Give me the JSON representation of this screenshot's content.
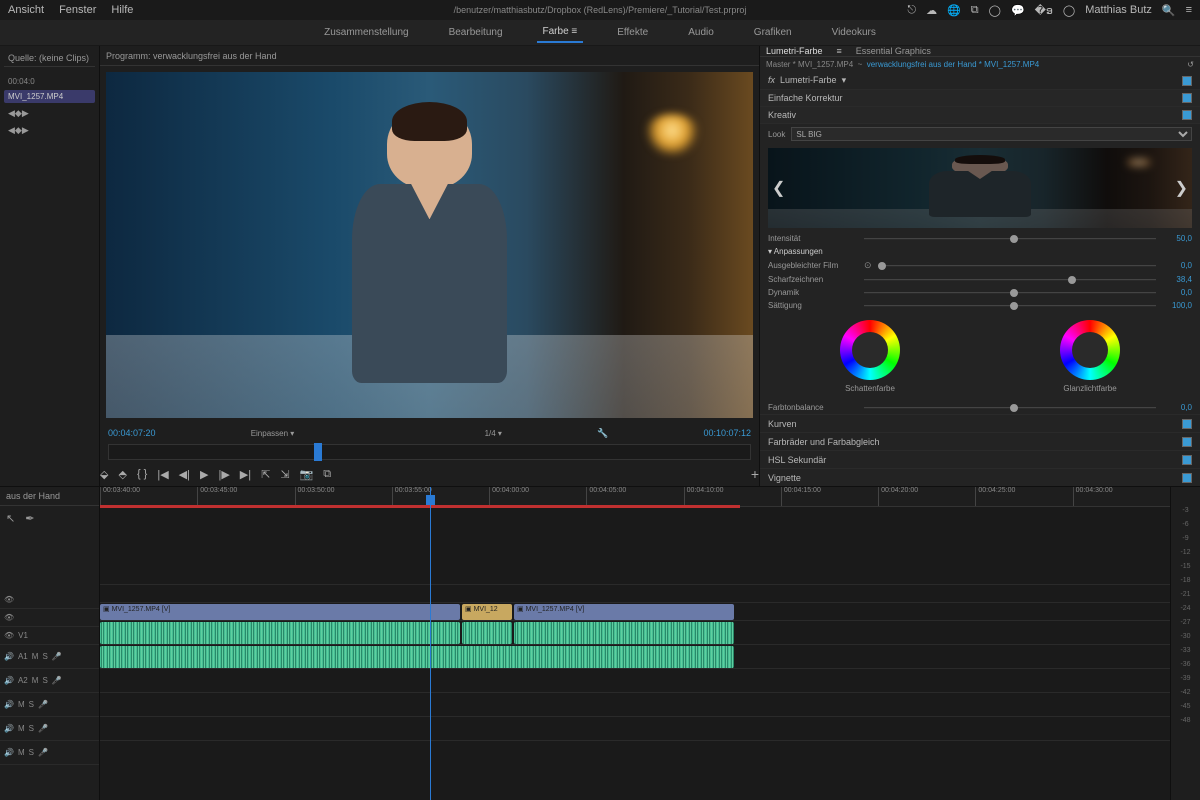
{
  "menubar": {
    "items": [
      "Ansicht",
      "Fenster",
      "Hilfe"
    ],
    "titlePath": "/benutzer/matthiasbutz/Dropbox (RedLens)/Premiere/_Tutorial/Test.prproj",
    "user": "Matthias Butz"
  },
  "workspaces": {
    "items": [
      "Zusammenstellung",
      "Bearbeitung",
      "Farbe",
      "Effekte",
      "Audio",
      "Grafiken",
      "Videokurs"
    ],
    "active": "Farbe"
  },
  "sourcePanel": {
    "tab": "Quelle: (keine Clips)",
    "effect": "MVI_1257.MP4"
  },
  "program": {
    "title": "Programm: verwacklungsfrei aus der Hand",
    "tcIn": "00:04:07:20",
    "fit": "Einpassen",
    "scale": "1/4",
    "tcOut": "00:10:07:12"
  },
  "lumetri": {
    "tabs": [
      "Lumetri-Farbe",
      "Essential Graphics"
    ],
    "activeTab": "Lumetri-Farbe",
    "pathMaster": "Master * MVI_1257.MP4",
    "pathClip": "verwacklungsfrei aus der Hand * MVI_1257.MP4",
    "fx": "Lumetri-Farbe",
    "sectionBasic": "Einfache Korrektur",
    "sectionCreative": "Kreativ",
    "look": {
      "label": "Look",
      "value": "SL BIG"
    },
    "sliders": {
      "intensity": {
        "label": "Intensität",
        "value": "50,0",
        "pos": 50
      },
      "adjustHeader": "Anpassungen",
      "fade": {
        "label": "Ausgebleichter Film",
        "value": "0,0",
        "pos": 0
      },
      "sharpen": {
        "label": "Scharfzeichnen",
        "value": "38,4",
        "pos": 70
      },
      "vibrance": {
        "label": "Dynamik",
        "value": "0,0",
        "pos": 50
      },
      "saturation": {
        "label": "Sättigung",
        "value": "100,0",
        "pos": 50
      }
    },
    "wheels": {
      "shadow": "Schattenfarbe",
      "highlight": "Glanzlichtfarbe"
    },
    "tintBalance": {
      "label": "Farbtonbalance",
      "value": "0,0",
      "pos": 50
    },
    "sections": [
      "Kurven",
      "Farbräder und Farbabgleich",
      "HSL Sekundär",
      "Vignette"
    ]
  },
  "timeline": {
    "seqName": "aus der Hand",
    "ticks": [
      "00:03:40:00",
      "00:03:45:00",
      "00:03:50:00",
      "00:03:55:00",
      "00:04:00:00",
      "00:04:05:00",
      "00:04:10:00",
      "00:04:15:00",
      "00:04:20:00",
      "00:04:25:00",
      "00:04:30:00"
    ],
    "clipV1": "MVI_1257.MP4 [V]",
    "clipV2": "MVI_12",
    "clipV3": "MVI_1257.MP4 [V]",
    "trackLabels": {
      "v1": "V1",
      "a1": "A1",
      "a2": "A2"
    },
    "dbScale": [
      "-3",
      "-6",
      "-9",
      "-12",
      "-15",
      "-18",
      "-21",
      "-24",
      "-27",
      "-30",
      "-33",
      "-36",
      "-39",
      "-42",
      "-45",
      "-48"
    ]
  }
}
